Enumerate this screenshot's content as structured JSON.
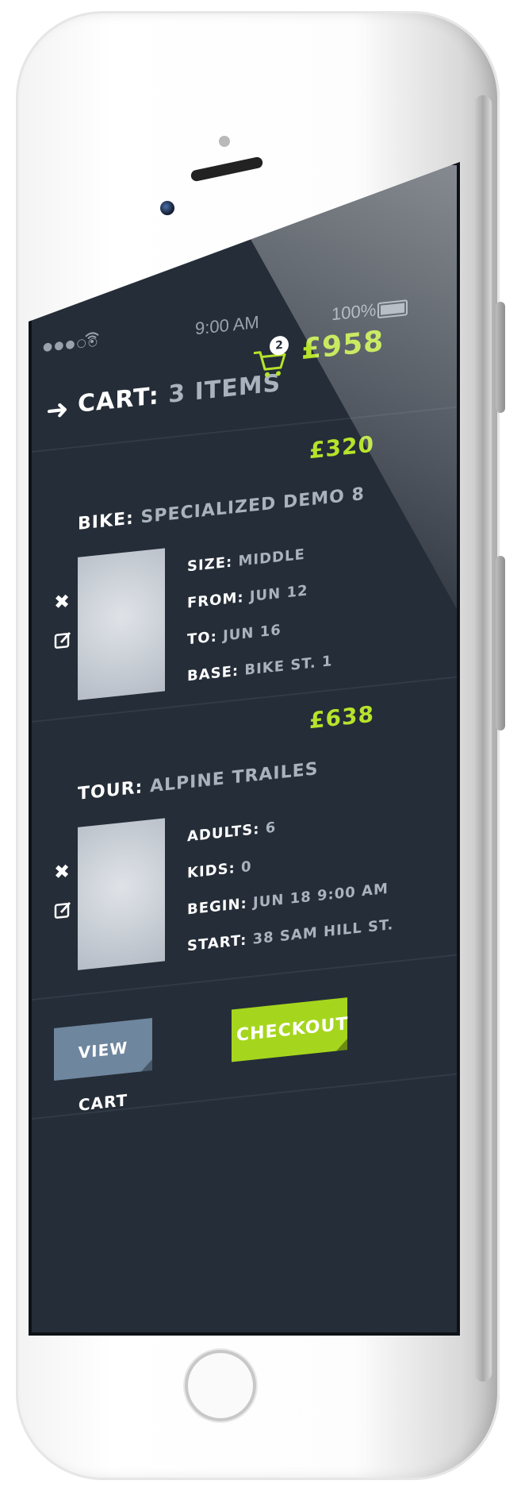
{
  "status_bar": {
    "signal": "●●●○○",
    "time": "9:00 AM",
    "battery": "100%"
  },
  "header": {
    "title_prefix": "CART:",
    "title_count": "3 ITEMS",
    "cart_badge": "2",
    "total": "£958"
  },
  "items": [
    {
      "price": "£320",
      "category": "BIKE:",
      "name": "SPECIALIZED DEMO 8",
      "details": [
        {
          "label": "SIZE:",
          "value": "MIDDLE"
        },
        {
          "label": "FROM:",
          "value": "JUN 12"
        },
        {
          "label": "TO:",
          "value": "JUN 16"
        },
        {
          "label": "BASE:",
          "value": "BIKE ST. 1"
        }
      ]
    },
    {
      "price": "£638",
      "category": "TOUR:",
      "name": "ALPINE TRAILES",
      "details": [
        {
          "label": "ADULTS:",
          "value": "6"
        },
        {
          "label": "KIDS:",
          "value": "0"
        },
        {
          "label": "BEGIN:",
          "value": "JUN 18 9:00 AM"
        },
        {
          "label": "START:",
          "value": "38 SAM HILL ST."
        }
      ]
    }
  ],
  "actions": {
    "view_cart": "VIEW CART",
    "checkout": "CHECKOUT"
  },
  "colors": {
    "background": "#252d38",
    "accent": "#b6e32b",
    "checkout": "#a5d61d",
    "secondary_button": "#6e869e"
  }
}
